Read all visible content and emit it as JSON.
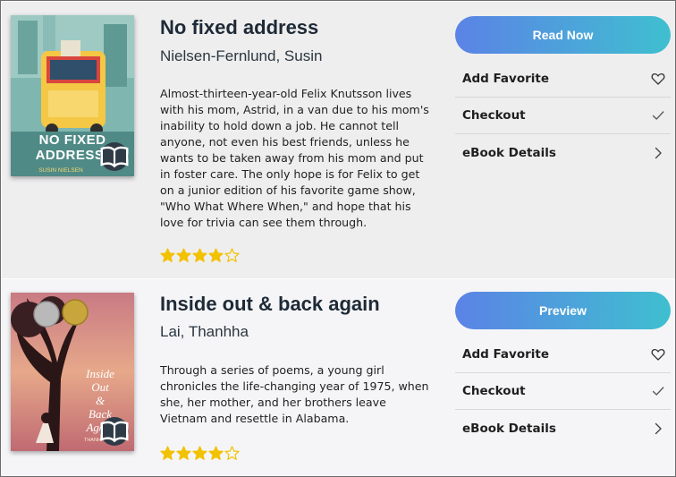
{
  "books": [
    {
      "title": "No fixed address",
      "author": "Nielsen-Fernlund, Susin",
      "description": "Almost-thirteen-year-old Felix Knutsson lives with his mom, Astrid, in a van due to his mom's inability to hold down a job. He cannot tell anyone, not even his best friends, unless he wants to be taken away from his mom and put in foster care. The only hope is for Felix to get on a junior edition of his favorite game show, \"Who What Where When,\" and hope that his love for trivia can see them through.",
      "rating": 4,
      "rating_max": 5,
      "action_label": "Read Now",
      "cover_text": {
        "line1": "NO FIXED",
        "line2": "ADDRESS",
        "author": "SUSIN NIELSEN"
      },
      "menu": [
        {
          "label": "Add Favorite",
          "icon": "heart-icon"
        },
        {
          "label": "Checkout",
          "icon": "check-icon"
        },
        {
          "label": "eBook Details",
          "icon": "chevron-right-icon"
        }
      ]
    },
    {
      "title": "Inside out & back again",
      "author": "Lai, Thanhha",
      "description": "Through a series of poems, a young girl chronicles the life-changing year of 1975, when she, her mother, and her brothers leave Vietnam and resettle in Alabama.",
      "rating": 4,
      "rating_max": 5,
      "action_label": "Preview",
      "cover_text": {
        "line1": "Inside",
        "line2": "Out",
        "line3": "&",
        "line4": "Back",
        "line5": "Again",
        "author": "THANHHA LAI"
      },
      "menu": [
        {
          "label": "Add Favorite",
          "icon": "heart-icon"
        },
        {
          "label": "Checkout",
          "icon": "check-icon"
        },
        {
          "label": "eBook Details",
          "icon": "chevron-right-icon"
        }
      ]
    }
  ],
  "colors": {
    "star": "#f2c200",
    "button_gradient_start": "#5b83e6",
    "button_gradient_end": "#3fbfd0",
    "title_text": "#1e2a36"
  }
}
